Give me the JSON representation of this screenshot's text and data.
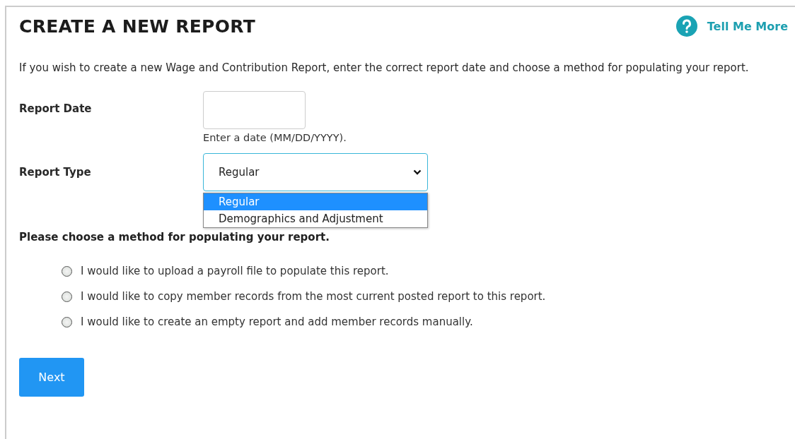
{
  "header": {
    "title": "CREATE A NEW REPORT",
    "help_link": "Tell Me More"
  },
  "intro": "If you wish to create a new Wage and Contribution Report, enter the correct report date and choose a method for populating your report.",
  "report_date": {
    "label": "Report Date",
    "hint": "Enter a date (MM/DD/YYYY)."
  },
  "report_type": {
    "label": "Report Type",
    "value": "Regular",
    "expanded": true,
    "options": [
      {
        "label": "Regular",
        "selected": true
      },
      {
        "label": "Demographics and Adjustment",
        "selected": false
      }
    ]
  },
  "method": {
    "prompt": "Please choose a method for populating your report.",
    "options": [
      {
        "label": "I would like to upload a payroll file to populate this report.",
        "selected": false
      },
      {
        "label": "I would like to copy member records from the most current posted report to this report.",
        "selected": false
      },
      {
        "label": "I would like to create an empty report and add member records manually.",
        "selected": false
      }
    ]
  },
  "next_button": "Next"
}
